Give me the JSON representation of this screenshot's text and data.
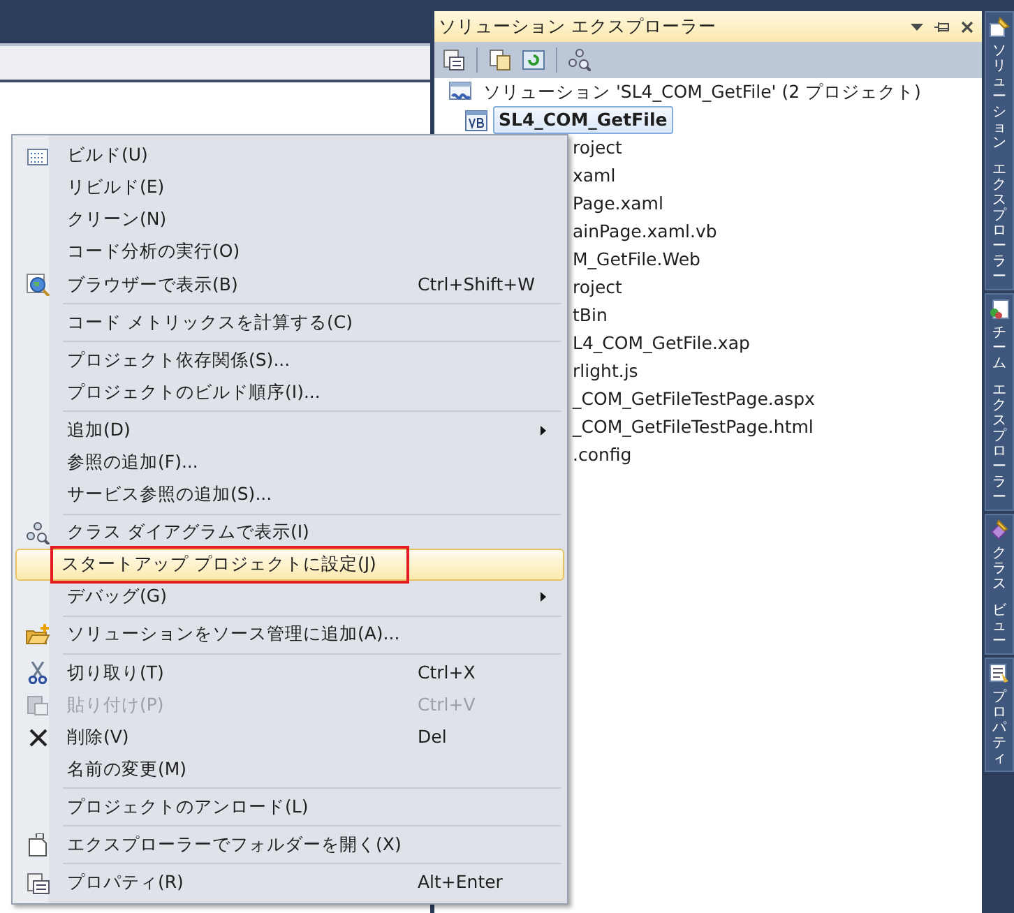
{
  "solution_explorer": {
    "title": "ソリューション エクスプローラー",
    "tree": [
      {
        "label": "ソリューション 'SL4_COM_GetFile' (2 プロジェクト)",
        "selected": false,
        "children": [
          {
            "label": "SL4_COM_GetFile",
            "selected": true,
            "children": [
              {
                "label": "roject",
                "selected": false
              },
              {
                "label": "xaml",
                "selected": false
              },
              {
                "label": "Page.xaml",
                "selected": false,
                "children": [
                  {
                    "label": "ainPage.xaml.vb",
                    "selected": false
                  }
                ]
              }
            ]
          },
          {
            "label": "M_GetFile.Web",
            "selected": false,
            "children": [
              {
                "label": "roject",
                "selected": false
              },
              {
                "label": "tBin",
                "selected": false,
                "children": [
                  {
                    "label": "L4_COM_GetFile.xap",
                    "selected": false
                  }
                ]
              },
              {
                "label": "rlight.js",
                "selected": false
              },
              {
                "label": "_COM_GetFileTestPage.aspx",
                "selected": false
              },
              {
                "label": "_COM_GetFileTestPage.html",
                "selected": false
              },
              {
                "label": ".config",
                "selected": false
              }
            ]
          }
        ]
      }
    ]
  },
  "context_menu": [
    {
      "kind": "item",
      "label": "ビルド(U)",
      "disabled": false,
      "highlighted": false,
      "submenu": false
    },
    {
      "kind": "item",
      "label": "リビルド(E)",
      "disabled": false,
      "highlighted": false,
      "submenu": false
    },
    {
      "kind": "item",
      "label": "クリーン(N)",
      "disabled": false,
      "highlighted": false,
      "submenu": false
    },
    {
      "kind": "item",
      "label": "コード分析の実行(O)",
      "disabled": false,
      "highlighted": false,
      "submenu": false
    },
    {
      "kind": "item",
      "label": "ブラウザーで表示(B)",
      "shortcut": "Ctrl+Shift+W",
      "disabled": false,
      "highlighted": false,
      "submenu": false
    },
    {
      "kind": "separator"
    },
    {
      "kind": "item",
      "label": "コード メトリックスを計算する(C)",
      "disabled": false,
      "highlighted": false,
      "submenu": false
    },
    {
      "kind": "separator"
    },
    {
      "kind": "item",
      "label": "プロジェクト依存関係(S)...",
      "disabled": false,
      "highlighted": false,
      "submenu": false
    },
    {
      "kind": "item",
      "label": "プロジェクトのビルド順序(I)...",
      "disabled": false,
      "highlighted": false,
      "submenu": false
    },
    {
      "kind": "separator"
    },
    {
      "kind": "item",
      "label": "追加(D)",
      "disabled": false,
      "highlighted": false,
      "submenu": true
    },
    {
      "kind": "item",
      "label": "参照の追加(F)...",
      "disabled": false,
      "highlighted": false,
      "submenu": false
    },
    {
      "kind": "item",
      "label": "サービス参照の追加(S)...",
      "disabled": false,
      "highlighted": false,
      "submenu": false
    },
    {
      "kind": "separator"
    },
    {
      "kind": "item",
      "label": "クラス ダイアグラムで表示(I)",
      "disabled": false,
      "highlighted": false,
      "submenu": false
    },
    {
      "kind": "item",
      "label": "スタートアップ プロジェクトに設定(J)",
      "disabled": false,
      "highlighted": true,
      "submenu": false,
      "annotated": true
    },
    {
      "kind": "item",
      "label": "デバッグ(G)",
      "disabled": false,
      "highlighted": false,
      "submenu": true
    },
    {
      "kind": "separator"
    },
    {
      "kind": "item",
      "label": "ソリューションをソース管理に追加(A)...",
      "disabled": false,
      "highlighted": false,
      "submenu": false
    },
    {
      "kind": "separator"
    },
    {
      "kind": "item",
      "label": "切り取り(T)",
      "shortcut": "Ctrl+X",
      "disabled": false,
      "highlighted": false,
      "submenu": false
    },
    {
      "kind": "item",
      "label": "貼り付け(P)",
      "shortcut": "Ctrl+V",
      "disabled": true,
      "highlighted": false,
      "submenu": false
    },
    {
      "kind": "item",
      "label": "削除(V)",
      "shortcut": "Del",
      "disabled": false,
      "highlighted": false,
      "submenu": false
    },
    {
      "kind": "item",
      "label": "名前の変更(M)",
      "disabled": false,
      "highlighted": false,
      "submenu": false
    },
    {
      "kind": "separator"
    },
    {
      "kind": "item",
      "label": "プロジェクトのアンロード(L)",
      "disabled": false,
      "highlighted": false,
      "submenu": false
    },
    {
      "kind": "separator"
    },
    {
      "kind": "item",
      "label": "エクスプローラーでフォルダーを開く(X)",
      "disabled": false,
      "highlighted": false,
      "submenu": false
    },
    {
      "kind": "separator"
    },
    {
      "kind": "item",
      "label": "プロパティ(R)",
      "shortcut": "Alt+Enter",
      "disabled": false,
      "highlighted": false,
      "submenu": false
    }
  ],
  "side_tabs": [
    {
      "words": [
        "ソリューション",
        "エクスプローラー"
      ]
    },
    {
      "words": [
        "チーム",
        "エクスプローラー"
      ]
    },
    {
      "words": [
        "クラス",
        "ビュー"
      ]
    },
    {
      "words": [
        "プロパティ"
      ]
    }
  ]
}
